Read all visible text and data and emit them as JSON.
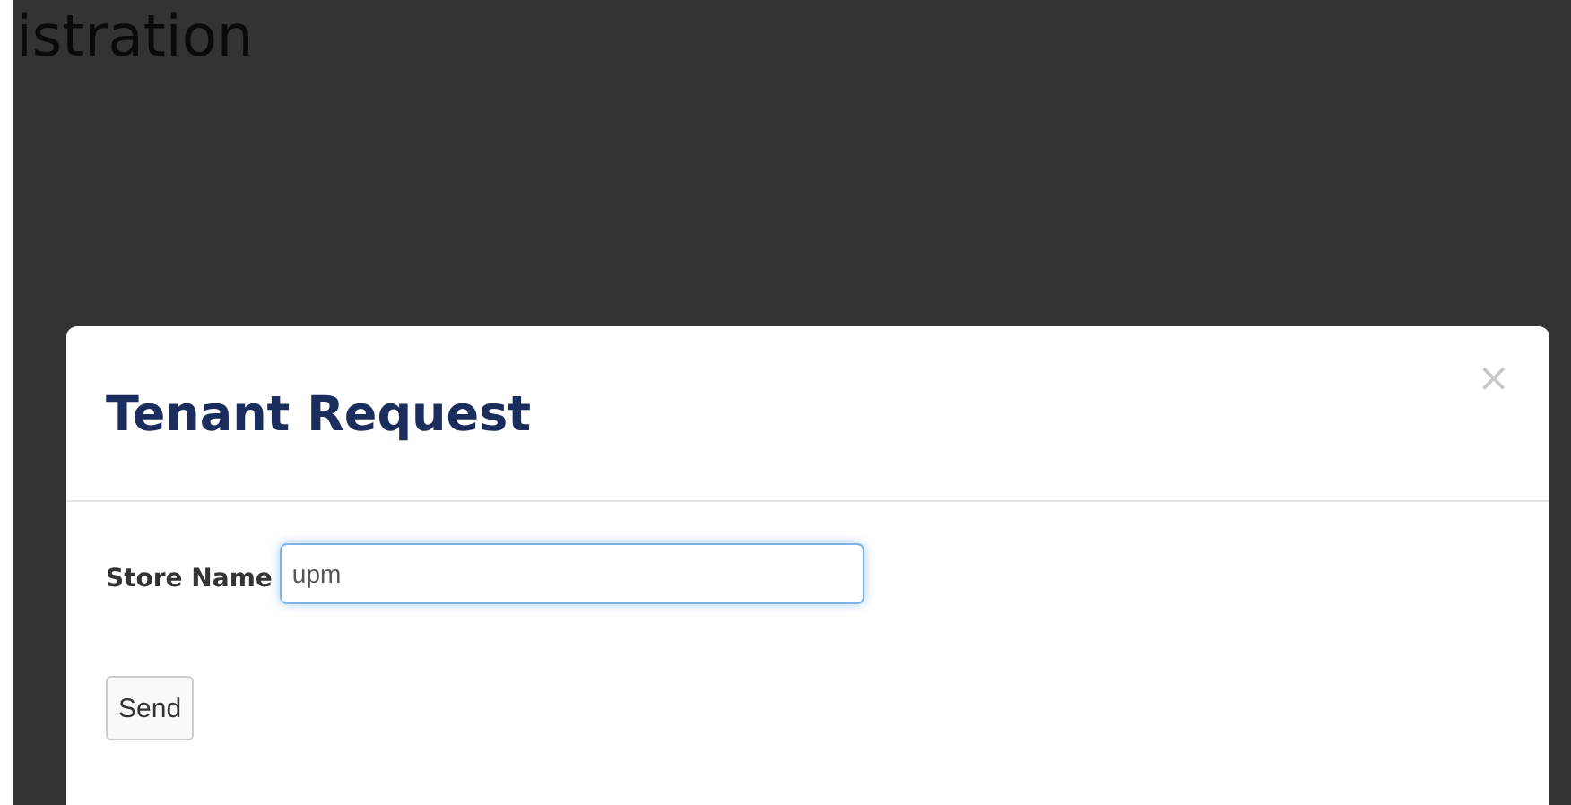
{
  "page": {
    "heading": "istration"
  },
  "modal": {
    "title": "Tenant Request",
    "close": "×",
    "fields": [
      {
        "label": "Store Name",
        "value": "upm",
        "focused": true
      }
    ],
    "buttons": [
      "Send"
    ]
  }
}
